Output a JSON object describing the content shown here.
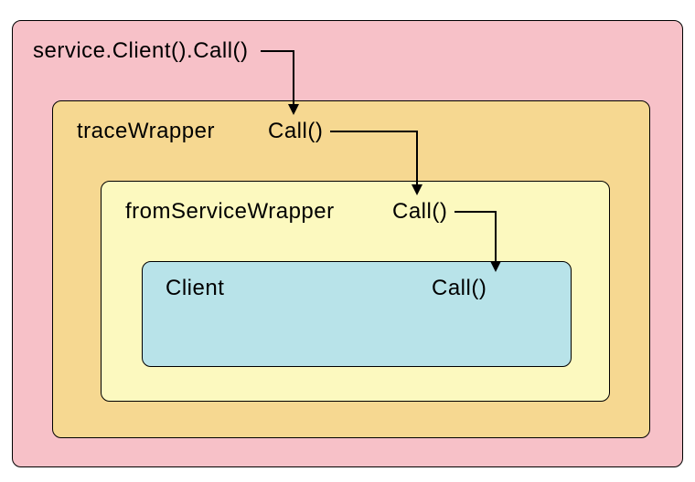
{
  "labels": {
    "outer_call": "service.Client().Call()",
    "trace_name": "traceWrapper",
    "trace_call": "Call()",
    "from_name": "fromServiceWrapper",
    "from_call": "Call()",
    "client_name": "Client",
    "client_call": "Call()"
  },
  "colors": {
    "outer": "#F7C1C8",
    "trace": "#F6D891",
    "from": "#FCF9BF",
    "client": "#B8E3E9",
    "border": "#000000"
  },
  "diagram": {
    "nesting": [
      "service.Client().Call()",
      "traceWrapper",
      "fromServiceWrapper",
      "Client"
    ],
    "call_chain": [
      "service.Client().Call()",
      "traceWrapper.Call()",
      "fromServiceWrapper.Call()",
      "Client.Call()"
    ]
  }
}
